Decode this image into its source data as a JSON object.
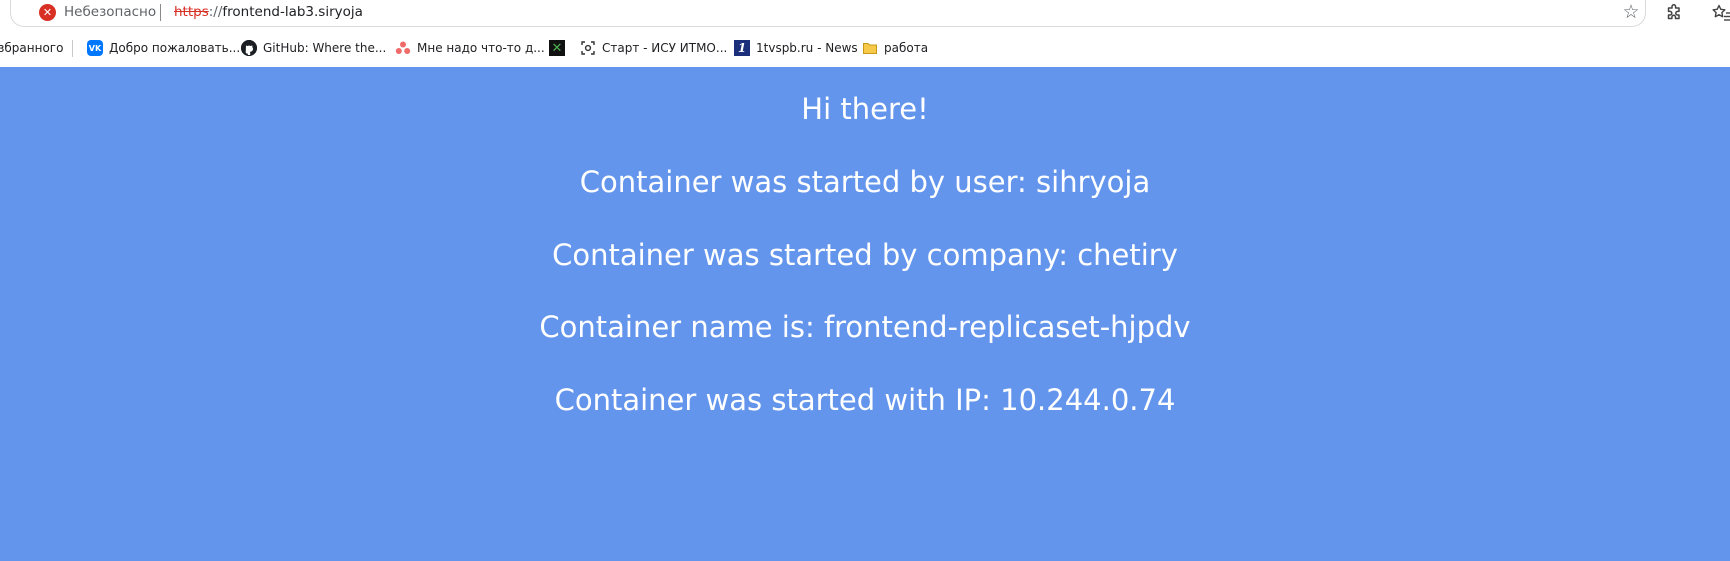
{
  "address_bar": {
    "security_label": "Небезопасно",
    "url_scheme": "https",
    "url_separator": "://",
    "url_host": "frontend-lab3.siryoja"
  },
  "bookmarks": [
    {
      "label": "збранного",
      "icon": "none"
    },
    {
      "label": "Добро пожаловать...",
      "icon": "vk-icon"
    },
    {
      "label": "GitHub: Where the...",
      "icon": "github-icon"
    },
    {
      "label": "Мне надо что-то д...",
      "icon": "asana-icon"
    },
    {
      "label": "",
      "icon": "x-icon"
    },
    {
      "label": "Старт - ИСУ ИТМО...",
      "icon": "itmo-icon"
    },
    {
      "label": "1tvspb.ru - News",
      "icon": "1tv-icon"
    },
    {
      "label": "работа",
      "icon": "folder-icon"
    }
  ],
  "page": {
    "background_color": "#6495ed",
    "text_color": "#ffffff",
    "lines": [
      "Hi there!",
      "Container was started by user: sihryoja",
      "Container was started by company: chetiry",
      "Container name is: frontend-replicaset-hjpdv",
      "Container was started with IP: 10.244.0.74"
    ]
  }
}
